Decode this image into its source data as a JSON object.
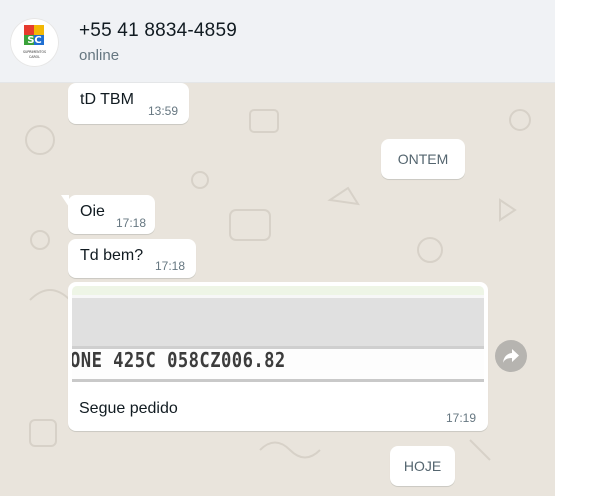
{
  "header": {
    "contact_name": "+55 41 8834-4859",
    "status": "online",
    "avatar_text_line1": "SUPRIMENTOS",
    "avatar_text_line2": "CAROL"
  },
  "messages": [
    {
      "text": "tD TBM",
      "time": "13:59"
    },
    {
      "text": "Oie",
      "time": "17:18"
    },
    {
      "text": "Td bem?",
      "time": "17:18"
    },
    {
      "image_text": "ONE 425C 058CZ006.82",
      "caption": "Segue pedido",
      "time": "17:19"
    }
  ],
  "date_chips": {
    "yesterday": "ONTEM",
    "today": "HOJE"
  },
  "icons": {
    "forward": "forward-icon"
  },
  "colors": {
    "chat_bg": "#e9e4dc",
    "header_bg": "#f0f2f5",
    "bubble_bg": "#ffffff",
    "time_text": "#667781"
  }
}
